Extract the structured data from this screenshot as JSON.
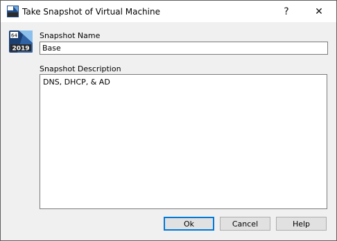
{
  "window": {
    "title": "Take Snapshot of Virtual Machine",
    "help_glyph": "?",
    "close_glyph": "✕"
  },
  "vm_icon": {
    "badge_top": "64",
    "badge_bottom": "2019"
  },
  "snapshot_name": {
    "label": "Snapshot Name",
    "value": "Base"
  },
  "snapshot_description": {
    "label": "Snapshot Description",
    "value": "DNS, DHCP, & AD"
  },
  "buttons": {
    "ok": "Ok",
    "cancel": "Cancel",
    "help": "Help"
  },
  "colors": {
    "accent": "#0078d7",
    "dialog_bg": "#f0f0f0"
  }
}
